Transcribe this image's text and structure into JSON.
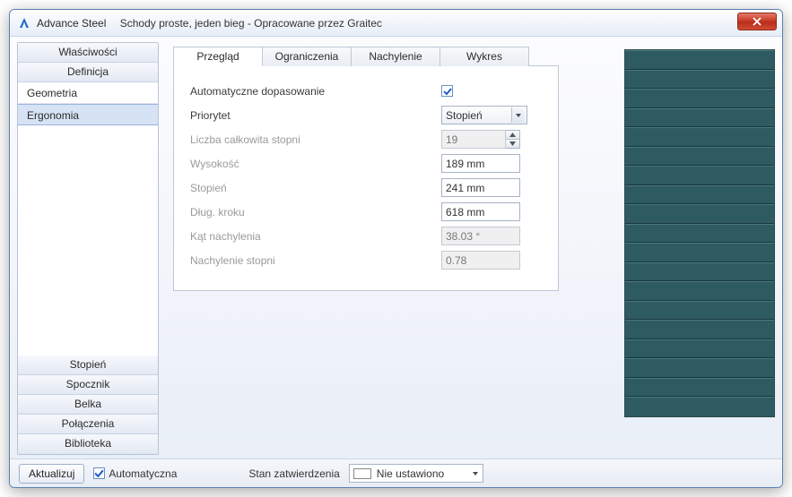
{
  "title": {
    "app": "Advance Steel",
    "doc": "Schody proste, jeden bieg - Opracowane przez Graitec"
  },
  "sidebar": {
    "top": [
      "Właściwości",
      "Definicja"
    ],
    "items": [
      "Geometria",
      "Ergonomia"
    ],
    "bottom": [
      "Stopień",
      "Spocznik",
      "Belka",
      "Połączenia",
      "Biblioteka"
    ]
  },
  "tabs": [
    "Przegląd",
    "Ograniczenia",
    "Nachylenie",
    "Wykres"
  ],
  "form": {
    "auto_fit_label": "Automatyczne dopasowanie",
    "auto_fit_checked": true,
    "priority_label": "Priorytet",
    "priority_value": "Stopień",
    "steps_total_label": "Liczba całkowita stopni",
    "steps_total_value": "19",
    "height_label": "Wysokość",
    "height_value": "189 mm",
    "tread_label": "Stopień",
    "tread_value": "241 mm",
    "stride_label": "Dług. kroku",
    "stride_value": "618 mm",
    "angle_label": "Kąt nachylenia",
    "angle_value": "38.03 °",
    "slope_label": "Nachylenie stopni",
    "slope_value": "0.78"
  },
  "preview": {
    "tread_count": 19
  },
  "footer": {
    "update_label": "Aktualizuj",
    "auto_label": "Automatyczna",
    "auto_checked": true,
    "status_label": "Stan zatwierdzenia",
    "status_value": "Nie ustawiono"
  }
}
